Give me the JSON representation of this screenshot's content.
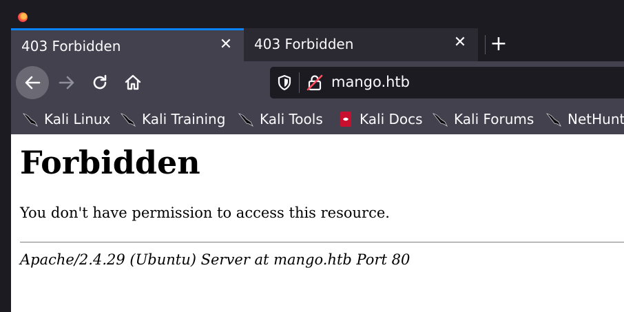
{
  "tabs": [
    {
      "title": "403 Forbidden",
      "active": true
    },
    {
      "title": "403 Forbidden",
      "active": false
    }
  ],
  "tab_close_glyph": "✕",
  "new_tab_glyph": "+",
  "urlbar": {
    "url": "mango.htb",
    "security_icon": "insecure-lock-icon",
    "tracking_icon": "shield-icon"
  },
  "nav": {
    "back_icon": "arrow-left-icon",
    "forward_icon": "arrow-right-icon",
    "reload_icon": "reload-icon",
    "home_icon": "home-icon"
  },
  "bookmarks": [
    {
      "label": "Kali Linux",
      "icon": "kali-dragon-icon"
    },
    {
      "label": "Kali Training",
      "icon": "kali-dragon-icon"
    },
    {
      "label": "Kali Tools",
      "icon": "kali-dragon-icon"
    },
    {
      "label": "Kali Docs",
      "icon": "kali-docs-icon"
    },
    {
      "label": "Kali Forums",
      "icon": "kali-dragon-icon"
    },
    {
      "label": "NetHunter",
      "icon": "kali-dragon-icon"
    }
  ],
  "page": {
    "heading": "Forbidden",
    "message": "You don't have permission to access this resource.",
    "server_signature": "Apache/2.4.29 (Ubuntu) Server at mango.htb Port 80"
  },
  "colors": {
    "accent": "#0a84ff",
    "toolbar": "#42414d",
    "frame": "#1c1b22",
    "text": "#fbfbfe"
  }
}
